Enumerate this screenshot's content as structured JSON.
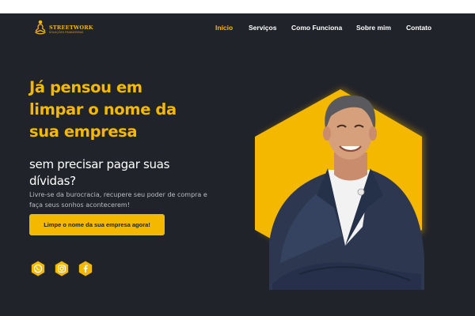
{
  "colors": {
    "accent": "#f5b800",
    "background": "#21232b",
    "text": "#ffffff",
    "muted": "#b9bcc6"
  },
  "logo": {
    "name": "STREETWORK",
    "tagline": "SOLUÇÕES FINANCEIRAS",
    "icon": "meditation-figure-icon"
  },
  "nav": {
    "items": [
      {
        "label": "Início",
        "active": true
      },
      {
        "label": "Serviços",
        "active": false
      },
      {
        "label": "Como Funciona",
        "active": false
      },
      {
        "label": "Sobre mim",
        "active": false
      },
      {
        "label": "Contato",
        "active": false
      }
    ]
  },
  "hero": {
    "title_lines": [
      "Já pensou em",
      "limpar o nome da",
      "sua empresa"
    ],
    "subtitle_lines": [
      "sem precisar pagar suas",
      "dívidas?"
    ],
    "description_lines": [
      "Livre-se da burocracia, recupere seu poder de compra e",
      "faça seus sonhos acontecerem!"
    ],
    "cta_label": "Limpe o nome da sua empresa agora!"
  },
  "socials": [
    {
      "icon": "whatsapp-icon"
    },
    {
      "icon": "instagram-icon"
    },
    {
      "icon": "facebook-icon"
    }
  ],
  "portrait": {
    "icon": "person-portrait-icon",
    "frame": "hexagon"
  }
}
